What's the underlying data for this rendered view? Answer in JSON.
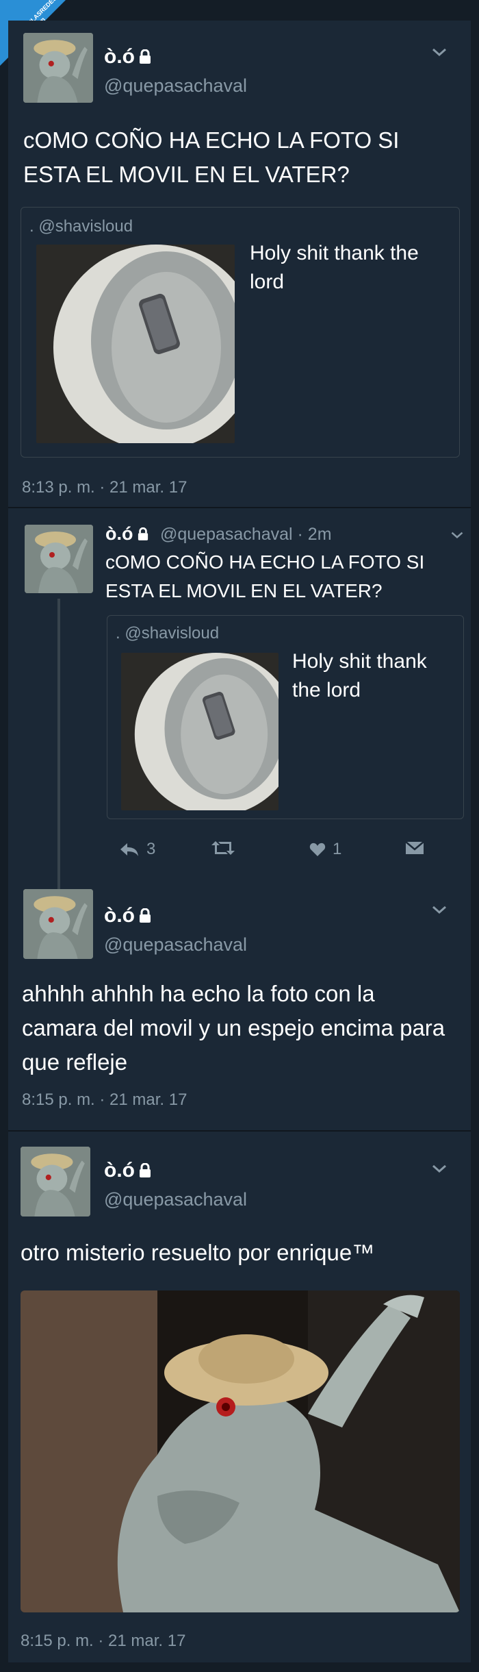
{
  "watermark": {
    "line1": "VISTOENLASREDES",
    "line2": ".com"
  },
  "tweets": [
    {
      "name": "ò.ó",
      "handle": "@quepasachaval",
      "text": "cOMO COÑO HA ECHO LA FOTO SI ESTA EL MOVIL EN EL VATER?",
      "quote": {
        "handle": ". @shavisloud",
        "text": "Holy shit thank the lord"
      },
      "time": "8:13 p. m. · 21 mar. 17"
    },
    {
      "name": "ò.ó",
      "handle": "@quepasachaval",
      "age": "· 2m",
      "text": "cOMO COÑO HA ECHO LA FOTO SI ESTA EL MOVIL EN EL VATER?",
      "quote": {
        "handle": ". @shavisloud",
        "text": "Holy shit thank the lord"
      },
      "actions": {
        "reply_count": "3",
        "retweet_count": "",
        "like_count": "1"
      }
    },
    {
      "name": "ò.ó",
      "handle": "@quepasachaval",
      "text": "ahhhh ahhhh ha echo la foto con la camara del movil y un espejo encima para que refleje",
      "time": "8:15 p. m. · 21 mar. 17"
    },
    {
      "name": "ò.ó",
      "handle": "@quepasachaval",
      "text": "otro misterio resuelto por enrique™",
      "time": "8:15 p. m. · 21 mar. 17"
    }
  ],
  "colors": {
    "background": "#141d26",
    "card": "#1b2836",
    "secondary_text": "#8899a6",
    "border": "#38444d",
    "watermark": "#2a8fd6"
  },
  "icons": [
    "lock-icon",
    "chevron-down-icon",
    "reply-icon",
    "retweet-icon",
    "like-icon",
    "dm-icon"
  ]
}
